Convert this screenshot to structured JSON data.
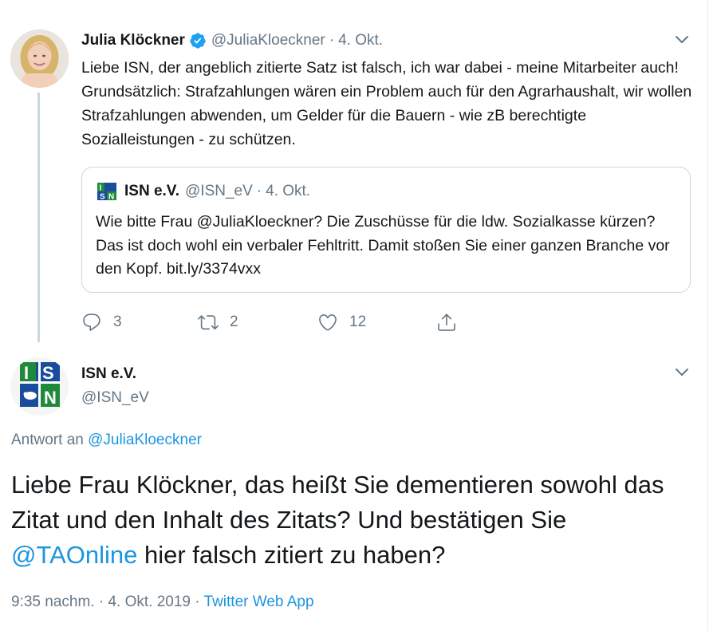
{
  "parent_tweet": {
    "author_name": "Julia Klöckner",
    "author_handle": "@JuliaKloeckner",
    "separator": "·",
    "date": "4. Okt.",
    "text": "Liebe ISN, der angeblich zitierte Satz ist falsch, ich war dabei - meine Mitarbeiter auch! Grundsätzlich: Strafzahlungen wären ein Problem auch für den Agrarhaushalt, wir wollen Strafzahlungen abwenden, um Gelder für die Bauern - wie zB berechtigte Sozialleistungen - zu schützen.",
    "quoted": {
      "author_name": "ISN e.V.",
      "author_handle": "@ISN_eV",
      "separator": "·",
      "date": "4. Okt.",
      "text": "Wie bitte Frau @JuliaKloeckner? Die Zuschüsse für die ldw. Sozialkasse kürzen? Das ist doch wohl ein verbaler Fehltritt. Damit stoßen Sie einer ganzen Branche vor den Kopf. bit.ly/3374vxx"
    },
    "actions": {
      "replies": "3",
      "retweets": "2",
      "likes": "12"
    }
  },
  "focused_tweet": {
    "author_name": "ISN e.V.",
    "author_handle": "@ISN_eV",
    "reply_prefix": "Antwort an",
    "reply_mention": "@JuliaKloeckner",
    "text_before": "Liebe Frau Klöckner, das heißt Sie dementieren sowohl das Zitat und den Inhalt des Zitats? Und bestätigen Sie",
    "text_mention": "@TAOnline",
    "text_after": " hier falsch zitiert zu haben?",
    "time": "9:35 nachm.",
    "separator1": " · ",
    "full_date": "4. Okt. 2019",
    "separator2": " · ",
    "source_app": "Twitter Web App"
  },
  "colors": {
    "link": "#1b95e0",
    "secondary_text": "#657786",
    "border": "#ccd6dd",
    "verified": "#1da1f2",
    "isn_blue": "#1a4c9c",
    "isn_green": "#1f8a3b"
  },
  "icons": {
    "verified": "verified-badge-icon",
    "caret": "chevron-down-icon",
    "reply": "reply-icon",
    "retweet": "retweet-icon",
    "like": "heart-icon",
    "share": "share-icon"
  }
}
